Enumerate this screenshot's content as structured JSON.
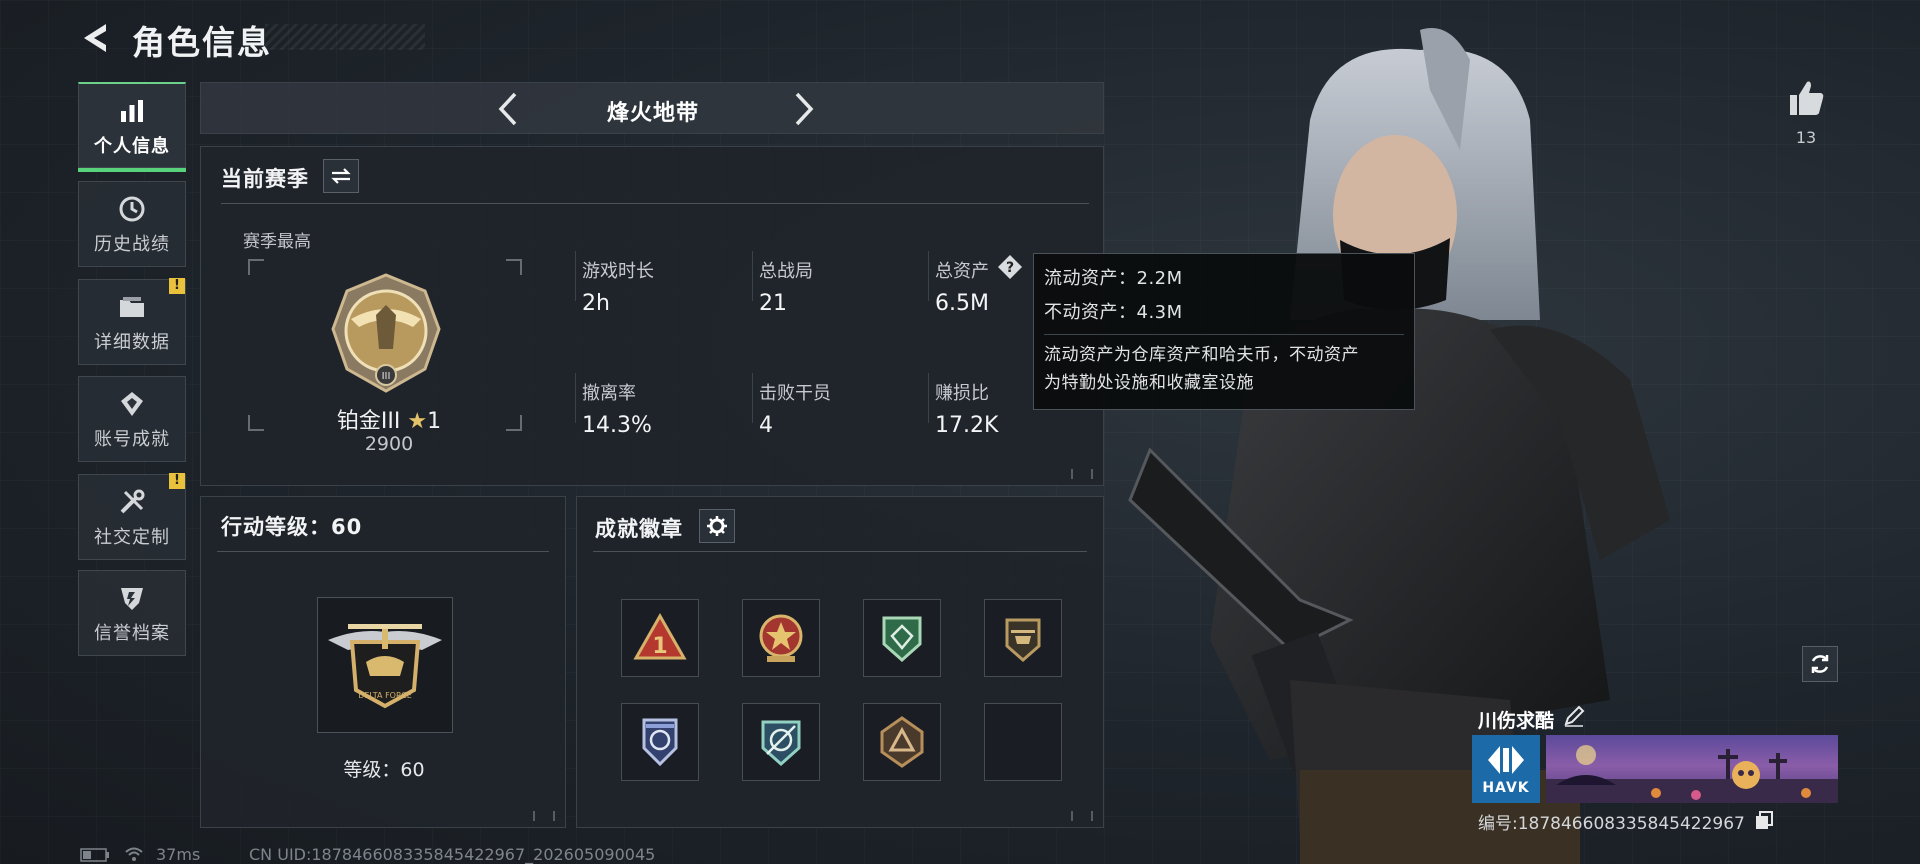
{
  "header": {
    "title": "角色信息"
  },
  "sidebar": {
    "items": [
      {
        "label": "个人信息",
        "icon": "bar-chart-icon",
        "active": true
      },
      {
        "label": "历史战绩",
        "icon": "history-clock-icon"
      },
      {
        "label": "详细数据",
        "icon": "folder-icon",
        "badge": "!"
      },
      {
        "label": "账号成就",
        "icon": "achievement-icon"
      },
      {
        "label": "社交定制",
        "icon": "tools-icon",
        "badge": "!"
      },
      {
        "label": "信誉档案",
        "icon": "credit-shield-icon"
      }
    ]
  },
  "mode": {
    "title": "烽火地带"
  },
  "season": {
    "title": "当前赛季",
    "best_label": "赛季最高",
    "rank_name": "铂金III",
    "rank_stars": "1",
    "rank_score": "2900",
    "stats": [
      {
        "label": "游戏时长",
        "value": "2h"
      },
      {
        "label": "总战局",
        "value": "21"
      },
      {
        "label": "总资产",
        "value": "6.5M"
      },
      {
        "label": "撤离率",
        "value": "14.3%"
      },
      {
        "label": "击败干员",
        "value": "4"
      },
      {
        "label": "赚损比",
        "value": "17.2K"
      }
    ]
  },
  "tooltip": {
    "liquid": "流动资产：2.2M",
    "fixed": "不动资产：4.3M",
    "desc_line1": "流动资产为仓库资产和哈夫币，不动资产",
    "desc_line2": "为特勤处设施和收藏室设施"
  },
  "action_level": {
    "title": "行动等级：60",
    "level_label": "等级：60"
  },
  "achievements": {
    "title": "成就徽章",
    "badges": [
      "triangle-1-badge",
      "star-medal-badge",
      "green-shield-badge",
      "helicopter-badge",
      "blue-shield-badge",
      "crosshair-badge",
      "bronze-triangle-badge",
      "empty-slot"
    ]
  },
  "player": {
    "likes": "13",
    "name": "川伤求酷",
    "team_logo_text": "HAVK",
    "id_text": "编号:1878466083358454229​67"
  },
  "status": {
    "ping": "37ms",
    "uid": "CN UID:1878466083358454229​67_202605090045"
  },
  "colors": {
    "accent_green": "#59d27c",
    "badge_yellow": "#e9c13b",
    "background": "#1b2026"
  }
}
